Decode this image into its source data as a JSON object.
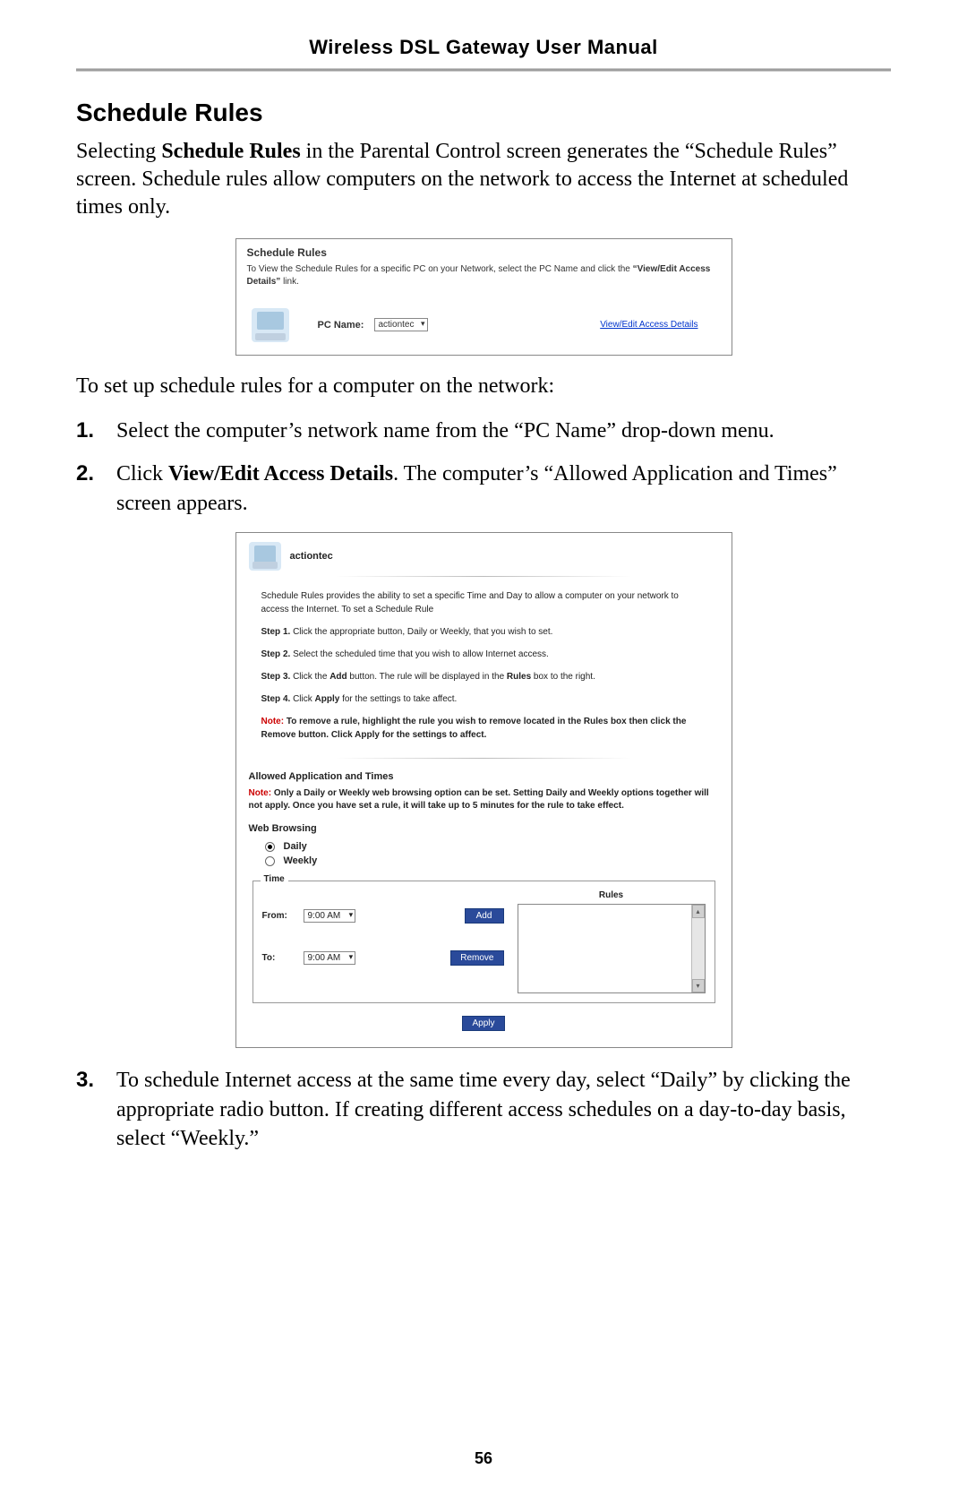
{
  "header": {
    "title": "Wireless DSL Gateway User Manual"
  },
  "section": {
    "heading": "Schedule Rules",
    "intro_p1": "Selecting ",
    "intro_b": "Schedule Rules",
    "intro_p2": " in the Parental Control screen generates the “Schedule Rules” screen. Schedule rules allow computers on the network to access the Internet at scheduled times only.",
    "setup_line": "To set up schedule rules for a computer on the network:"
  },
  "step1": {
    "num": "1.",
    "text": "Select the computer’s network name from the “PC Name” drop-down menu."
  },
  "step2": {
    "num": "2.",
    "pre": "Click ",
    "bold": "View/Edit Access Details",
    "post": ". The computer’s “Allowed Application and Times” screen appears."
  },
  "step3": {
    "num": "3.",
    "text": "To schedule Internet access at the same time every day, select “Daily” by clicking the appropriate radio button. If creating different access schedules on a day-to-day basis, select “Weekly.”"
  },
  "shot1": {
    "title": "Schedule Rules",
    "desc1": "To View the Schedule Rules for a specific PC on your Network, select the PC Name and click the ",
    "desc_q": "“View/Edit Access Details”",
    "desc2": " link.",
    "pc_label": "PC Name:",
    "pc_value": "actiontec",
    "link": "View/Edit Access Details"
  },
  "shot2": {
    "hostname": "actiontec",
    "intro": "Schedule Rules provides the ability to set a specific Time and Day to allow a computer on your network to access the Internet. To set a Schedule Rule",
    "s1b": "Step 1.",
    "s1t": " Click the appropriate button, Daily or Weekly, that you wish to set.",
    "s2b": "Step 2.",
    "s2t": " Select the scheduled time that you wish to allow Internet access.",
    "s3b": "Step 3.",
    "s3t_a": " Click the ",
    "s3t_b": "Add",
    "s3t_c": " button. The rule will be displayed in the ",
    "s3t_d": "Rules",
    "s3t_e": " box to the right.",
    "s4b": "Step 4.",
    "s4t_a": " Click ",
    "s4t_b": "Apply",
    "s4t_c": " for the settings to take affect.",
    "note_label": "Note:",
    "note_text": " To remove a rule, highlight the rule you wish to remove located in the Rules box then click the Remove button. Click Apply for the settings to affect.",
    "allowed_heading": "Allowed Application and Times",
    "note2_text": " Only a Daily or Weekly web browsing option can be set. Setting Daily and Weekly options together will not apply. Once you have set a rule, it will take up to 5 minutes for the rule to take effect.",
    "web_browsing": "Web Browsing",
    "daily": "Daily",
    "weekly": "Weekly",
    "time_legend": "Time",
    "from_label": "From:",
    "to_label": "To:",
    "from_val": "9:00 AM",
    "to_val": "9:00 AM",
    "add_btn": "Add",
    "remove_btn": "Remove",
    "rules_label": "Rules",
    "apply_btn": "Apply"
  },
  "page_number": "56"
}
